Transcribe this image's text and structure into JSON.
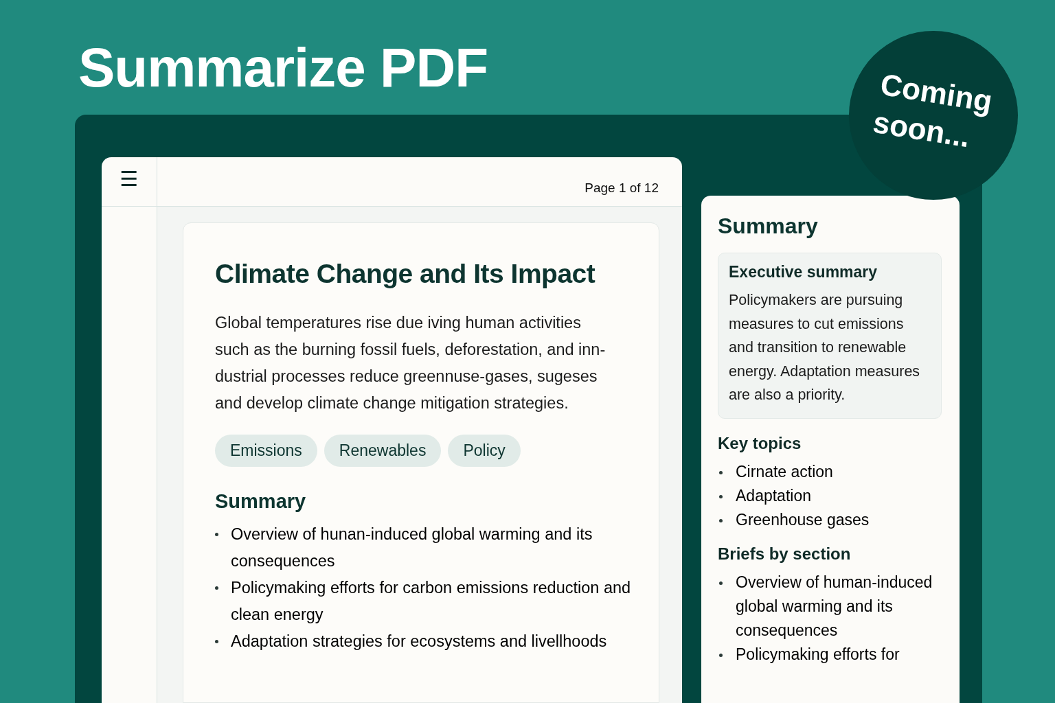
{
  "hero_title": "Summarize PDF",
  "badge": {
    "text_lines": [
      "Coming",
      "soon..."
    ]
  },
  "viewer": {
    "menu_icon": "☰",
    "page_indicator": "Page 1 of 12",
    "document": {
      "title": "Climate Change and Its Impact",
      "paragraph_lines": [
        "Global temperatures rise due iving human activities",
        "such as the burning fossil fuels, deforestation, and inn-",
        "dustrial processes reduce greennuse-gases, sugeses",
        "and develop climate change mitigation strategies."
      ],
      "tags": [
        "Emissions",
        "Renewables",
        "Policy"
      ],
      "summary_heading": "Summary",
      "summary_items": [
        "Overview of hunan-induced global warming and its consequences",
        "Policymaking efforts for carbon emissions reduction and clean energy",
        "Adaptation strategies for ecosystems and livellhoods"
      ]
    }
  },
  "summary_panel": {
    "title": "Summary",
    "executive": {
      "heading": "Executive summary",
      "text": "Policymakers are pursuing measures to cut emissions and transition to renewable energy. Adaptation measures are also a priority."
    },
    "key_topics": {
      "heading": "Key topics",
      "items": [
        "Cirnate action",
        "Adaptation",
        "Greenhouse gases"
      ]
    },
    "briefs": {
      "heading": "Briefs by section",
      "items": [
        "Overview of human-induced global warming and its consequences",
        "Policymaking efforts for"
      ]
    }
  }
}
